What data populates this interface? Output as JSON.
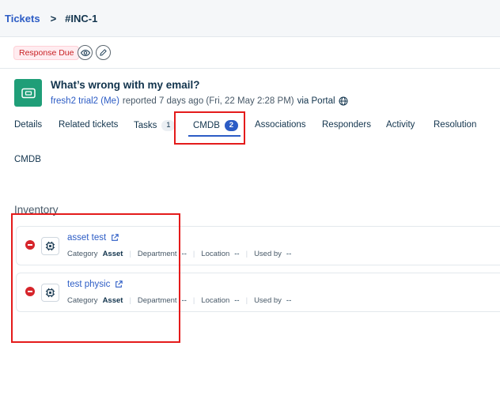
{
  "breadcrumb": {
    "parent": "Tickets",
    "separator": ">",
    "current": "#INC-1"
  },
  "status": {
    "badge": "Response Due"
  },
  "ticket": {
    "title": "What’s wrong with my email?",
    "requester": "fresh2 trial2 (Me)",
    "reported": "reported 7 days ago (Fri, 22 May 2:28 PM)",
    "via": "via Portal"
  },
  "tabs": [
    {
      "label": "Details"
    },
    {
      "label": "Related tickets"
    },
    {
      "label": "Tasks",
      "count": "1"
    },
    {
      "label": "CMDB",
      "count": "2",
      "active": true
    },
    {
      "label": "Associations"
    },
    {
      "label": "Responders"
    },
    {
      "label": "Activity"
    },
    {
      "label": "Resolution"
    }
  ],
  "section_label": "CMDB",
  "inventory": {
    "title": "Inventory",
    "labels": {
      "category": "Category",
      "department": "Department",
      "location": "Location",
      "used_by": "Used by"
    },
    "items": [
      {
        "name": "asset test",
        "category": "Asset",
        "department": "--",
        "location": "--",
        "used_by": "--"
      },
      {
        "name": "test physic",
        "category": "Asset",
        "department": "--",
        "location": "--",
        "used_by": "--"
      }
    ]
  },
  "colors": {
    "accent": "#2c5cc5",
    "ticket_icon": "#1f9e78",
    "danger": "#d6252b",
    "highlight": "#e41b1b"
  }
}
